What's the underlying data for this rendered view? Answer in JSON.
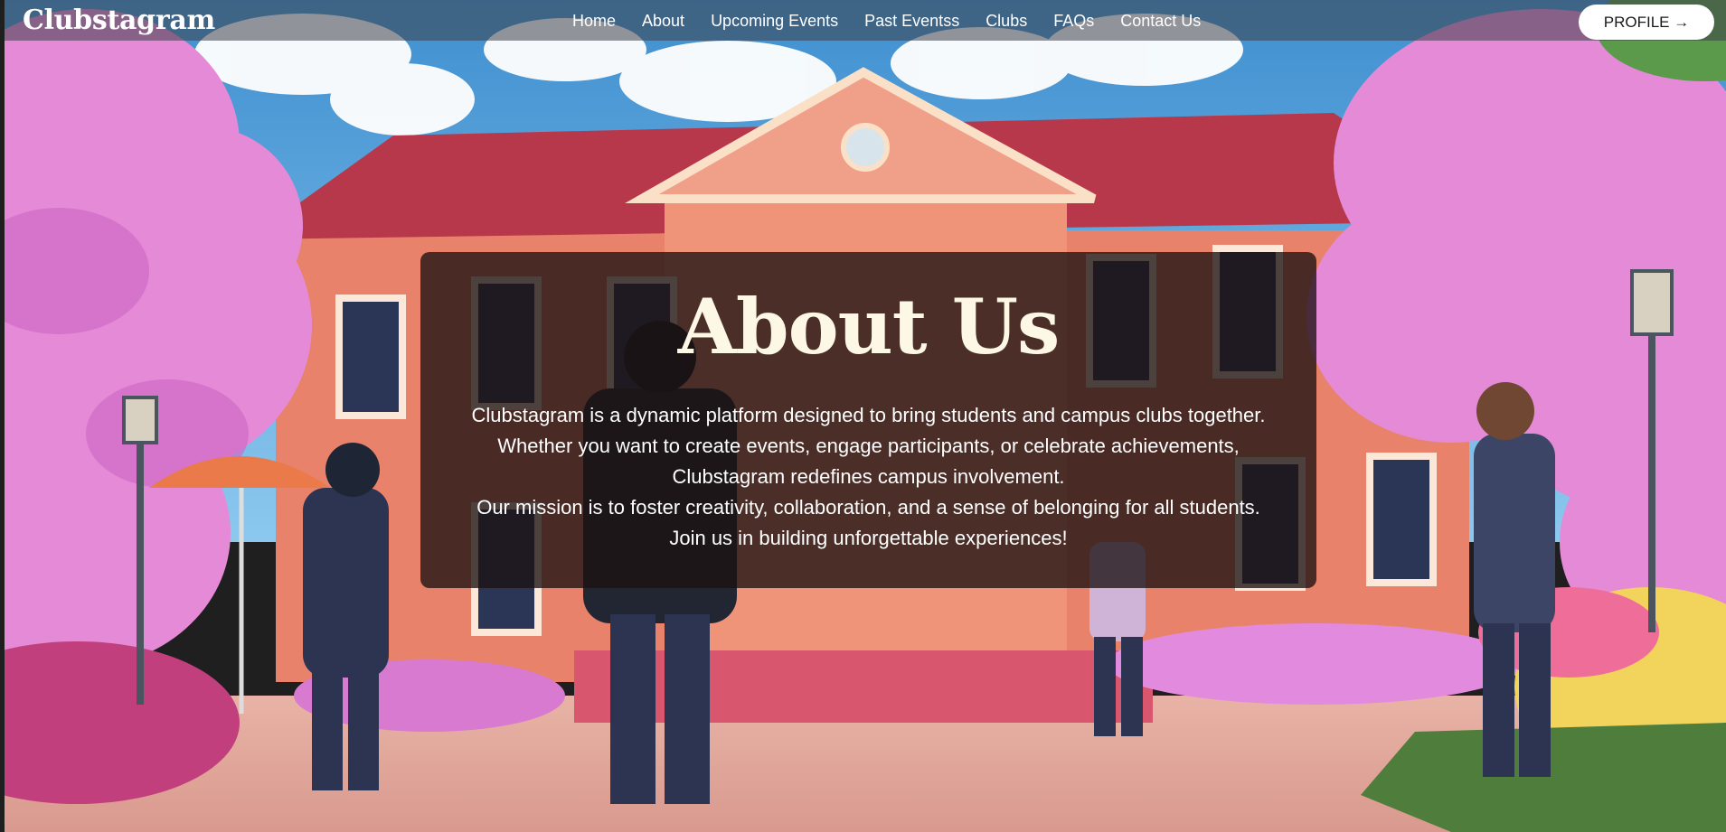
{
  "navbar": {
    "brand": "Clubstagram",
    "links": [
      "Home",
      "About",
      "Upcoming Events",
      "Past Eventss",
      "Clubs",
      "FAQs",
      "Contact Us"
    ],
    "profile_label": "PROFILE →"
  },
  "about": {
    "title": "About Us",
    "lines": [
      "Clubstagram is a dynamic platform designed to bring students and campus clubs together.",
      "Whether you want to create events, engage participants, or celebrate achievements,",
      "Clubstagram redefines campus involvement.",
      "Our mission is to foster creativity, collaboration, and a sense of belonging for all students.",
      "Join us in building unforgettable experiences!"
    ]
  },
  "colors": {
    "navbar_bg": "#3c4048",
    "card_bg": "#1c1212",
    "title_color": "#fdf7e6",
    "sky": "#4fa6de",
    "blossom": "#e58ad6",
    "building": "#e8826b",
    "roof": "#b7384a"
  },
  "icons": [
    "arrow-right-icon"
  ]
}
